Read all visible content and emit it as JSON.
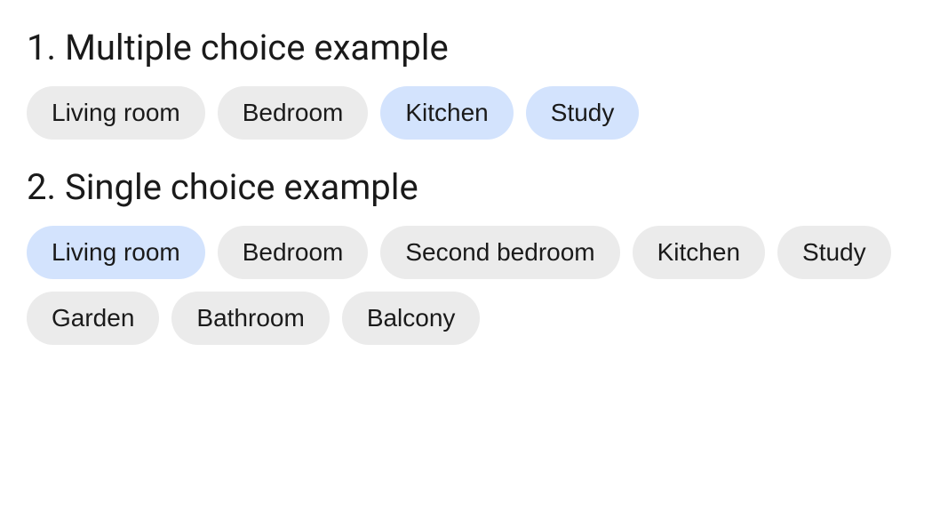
{
  "section1": {
    "title": "1. Multiple choice example",
    "chips": [
      {
        "label": "Living room",
        "selected": false
      },
      {
        "label": "Bedroom",
        "selected": false
      },
      {
        "label": "Kitchen",
        "selected": true
      },
      {
        "label": "Study",
        "selected": true
      }
    ]
  },
  "section2": {
    "title": "2. Single choice example",
    "chips": [
      {
        "label": "Living room",
        "selected": true
      },
      {
        "label": "Bedroom",
        "selected": false
      },
      {
        "label": "Second bedroom",
        "selected": false
      },
      {
        "label": "Kitchen",
        "selected": false
      },
      {
        "label": "Study",
        "selected": false
      },
      {
        "label": "Garden",
        "selected": false
      },
      {
        "label": "Bathroom",
        "selected": false
      },
      {
        "label": "Balcony",
        "selected": false
      }
    ]
  }
}
